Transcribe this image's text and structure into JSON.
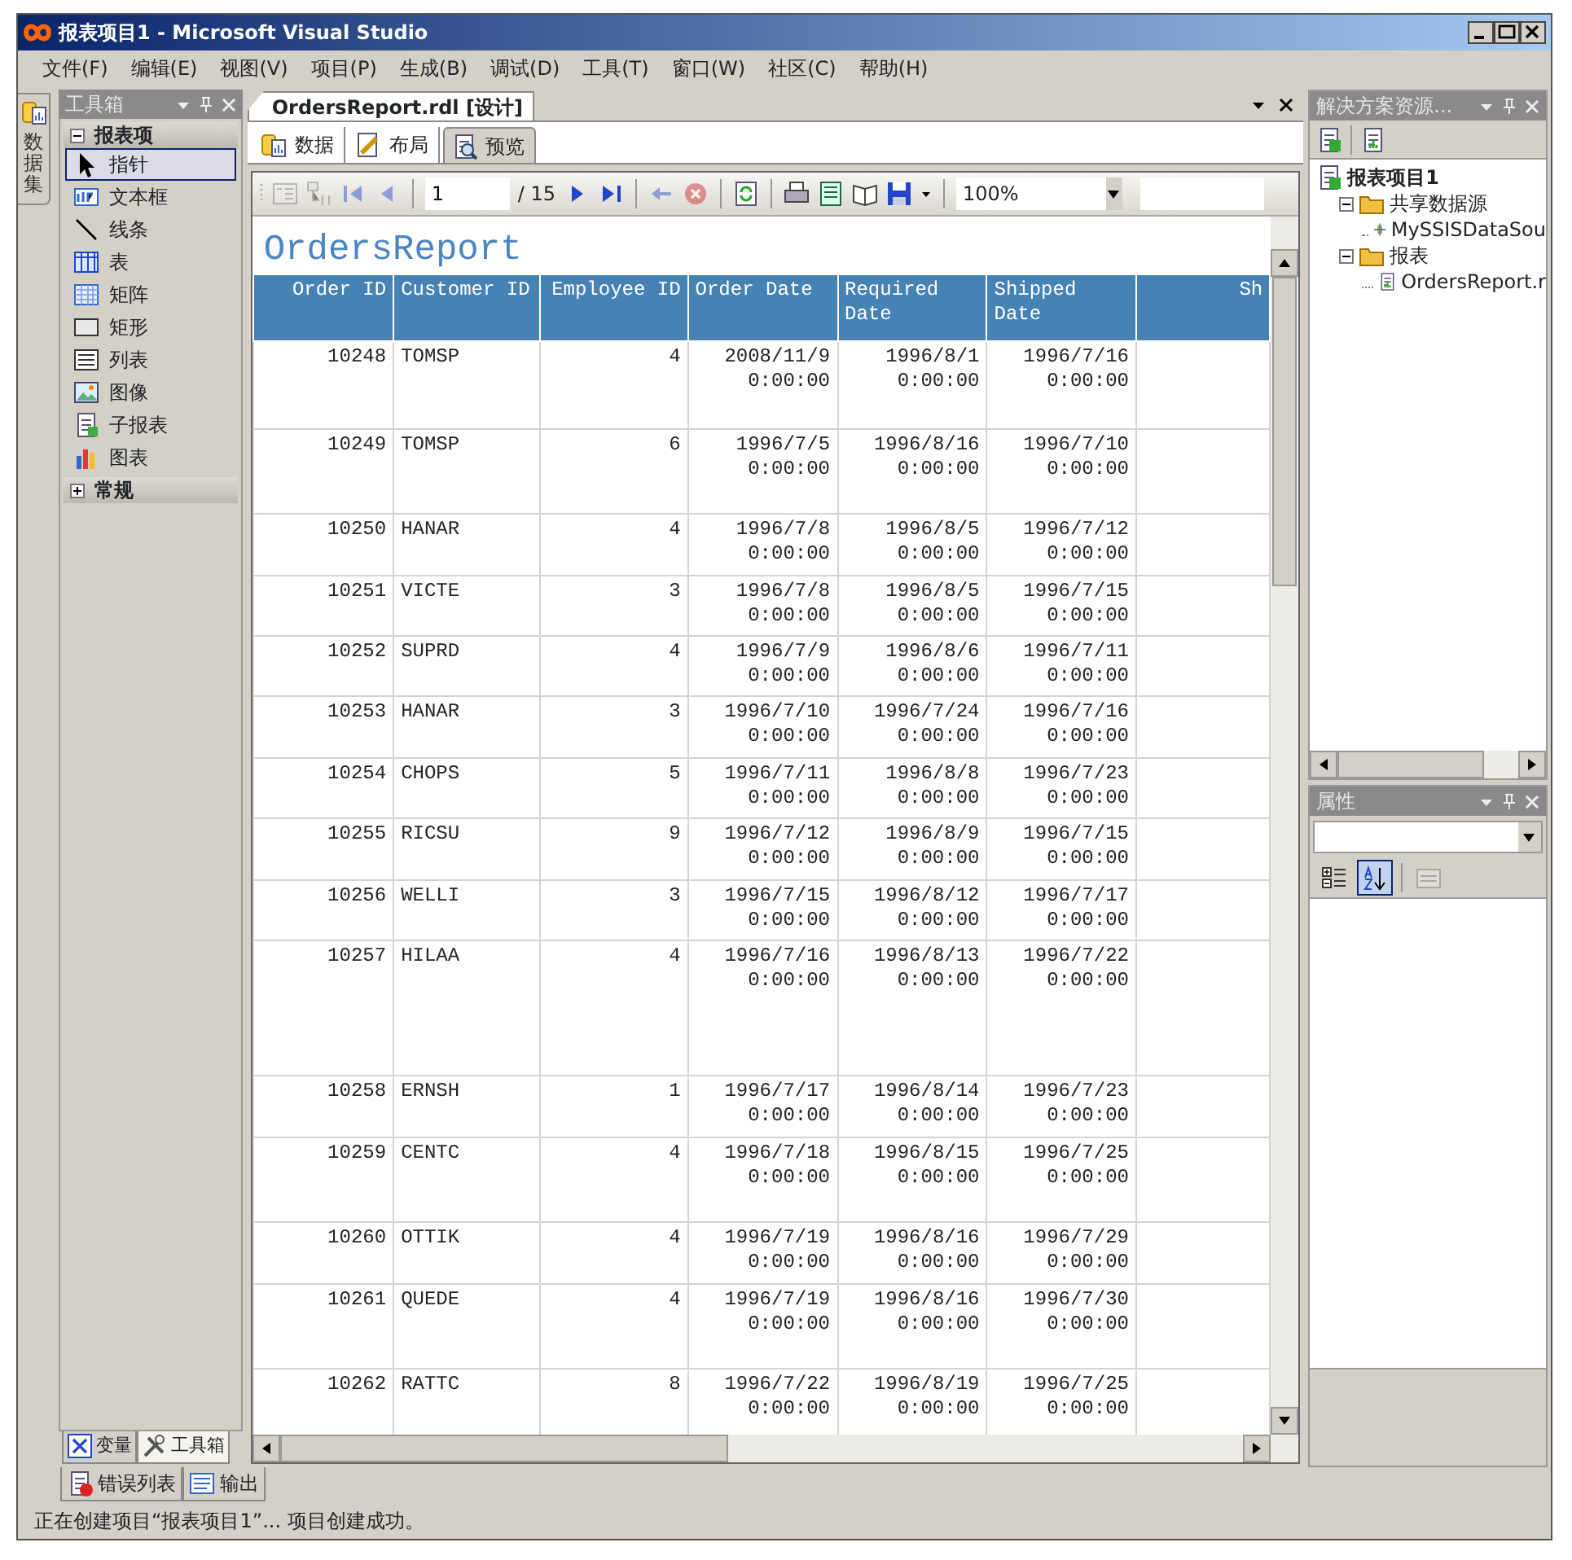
{
  "window": {
    "title": "报表项目1 - Microsoft Visual Studio"
  },
  "menu": [
    "文件(F)",
    "编辑(E)",
    "视图(V)",
    "项目(P)",
    "生成(B)",
    "调试(D)",
    "工具(T)",
    "窗口(W)",
    "社区(C)",
    "帮助(H)"
  ],
  "side_tabs": [
    {
      "label": "数据集"
    }
  ],
  "toolbox": {
    "title": "工具箱",
    "groups": [
      {
        "label": "报表项",
        "expanded": true,
        "items": [
          {
            "label": "指针",
            "kind": "pointer",
            "selected": true
          },
          {
            "label": "文本框",
            "kind": "textbox",
            "selected": false
          },
          {
            "label": "线条",
            "kind": "line",
            "selected": false
          },
          {
            "label": "表",
            "kind": "table",
            "selected": false
          },
          {
            "label": "矩阵",
            "kind": "matrix",
            "selected": false
          },
          {
            "label": "矩形",
            "kind": "rectangle",
            "selected": false
          },
          {
            "label": "列表",
            "kind": "list",
            "selected": false
          },
          {
            "label": "图像",
            "kind": "image",
            "selected": false
          },
          {
            "label": "子报表",
            "kind": "subreport",
            "selected": false
          },
          {
            "label": "图表",
            "kind": "chart",
            "selected": false
          }
        ]
      },
      {
        "label": "常规",
        "expanded": false
      }
    ]
  },
  "toolbox_tabs": [
    {
      "label": "变量",
      "kind": "variables",
      "selected": false
    },
    {
      "label": "工具箱",
      "kind": "toolbox",
      "selected": true
    }
  ],
  "document": {
    "tab": "OrdersReport.rdl [设计]",
    "view_tabs": [
      {
        "label": "数据",
        "kind": "data",
        "selected": false
      },
      {
        "label": "布局",
        "kind": "layout",
        "selected": false
      },
      {
        "label": "预览",
        "kind": "preview",
        "selected": true
      }
    ],
    "viewer_toolbar": {
      "left": [
        {
          "kind": "document-map",
          "disabled": true
        },
        {
          "kind": "parent-report",
          "disabled": true
        },
        {
          "kind": "first-page",
          "disabled": true
        },
        {
          "kind": "previous-page",
          "disabled": true
        }
      ],
      "page": "1",
      "page_total": "/ 15",
      "right": [
        {
          "kind": "next-page",
          "disabled": false
        },
        {
          "kind": "last-page",
          "disabled": false
        },
        {
          "kind": "back",
          "disabled": true
        },
        {
          "kind": "stop",
          "disabled": true
        },
        {
          "kind": "refresh",
          "disabled": false
        },
        {
          "kind": "print",
          "disabled": false
        },
        {
          "kind": "print-layout",
          "disabled": false
        },
        {
          "kind": "page-setup",
          "disabled": false
        },
        {
          "kind": "save",
          "disabled": false
        }
      ],
      "zoom": "100%"
    },
    "report": {
      "title": "OrdersReport",
      "columns": [
        "Order ID",
        "Customer ID",
        "Employee ID",
        "Order Date",
        "Required Date",
        "Shipped Date",
        "Sh"
      ],
      "rows": [
        [
          "10248",
          "TOMSP",
          "4",
          "2008/11/9 0:00:00",
          "1996/8/1 0:00:00",
          "1996/7/16 0:00:00"
        ],
        [
          "10249",
          "TOMSP",
          "6",
          "1996/7/5 0:00:00",
          "1996/8/16 0:00:00",
          "1996/7/10 0:00:00"
        ],
        [
          "10250",
          "HANAR",
          "4",
          "1996/7/8 0:00:00",
          "1996/8/5 0:00:00",
          "1996/7/12 0:00:00"
        ],
        [
          "10251",
          "VICTE",
          "3",
          "1996/7/8 0:00:00",
          "1996/8/5 0:00:00",
          "1996/7/15 0:00:00"
        ],
        [
          "10252",
          "SUPRD",
          "4",
          "1996/7/9 0:00:00",
          "1996/8/6 0:00:00",
          "1996/7/11 0:00:00"
        ],
        [
          "10253",
          "HANAR",
          "3",
          "1996/7/10 0:00:00",
          "1996/7/24 0:00:00",
          "1996/7/16 0:00:00"
        ],
        [
          "10254",
          "CHOPS",
          "5",
          "1996/7/11 0:00:00",
          "1996/8/8 0:00:00",
          "1996/7/23 0:00:00"
        ],
        [
          "10255",
          "RICSU",
          "9",
          "1996/7/12 0:00:00",
          "1996/8/9 0:00:00",
          "1996/7/15 0:00:00"
        ],
        [
          "10256",
          "WELLI",
          "3",
          "1996/7/15 0:00:00",
          "1996/8/12 0:00:00",
          "1996/7/17 0:00:00"
        ],
        [
          "10257",
          "HILAA",
          "4",
          "1996/7/16 0:00:00",
          "1996/8/13 0:00:00",
          "1996/7/22 0:00:00"
        ],
        [
          "10258",
          "ERNSH",
          "1",
          "1996/7/17 0:00:00",
          "1996/8/14 0:00:00",
          "1996/7/23 0:00:00"
        ],
        [
          "10259",
          "CENTC",
          "4",
          "1996/7/18 0:00:00",
          "1996/8/15 0:00:00",
          "1996/7/25 0:00:00"
        ],
        [
          "10260",
          "OTTIK",
          "4",
          "1996/7/19 0:00:00",
          "1996/8/16 0:00:00",
          "1996/7/29 0:00:00"
        ],
        [
          "10261",
          "QUEDE",
          "4",
          "1996/7/19 0:00:00",
          "1996/8/16 0:00:00",
          "1996/7/30 0:00:00"
        ],
        [
          "10262",
          "RATTC",
          "8",
          "1996/7/22 0:00:00",
          "1996/8/19 0:00:00",
          "1996/7/25 0:00:00"
        ]
      ]
    }
  },
  "solution_explorer": {
    "title": "解决方案资源...",
    "tree": [
      {
        "label": "报表项目1",
        "kind": "project",
        "children": [
          {
            "label": "共享数据源",
            "kind": "folder",
            "expanded": true,
            "children": [
              {
                "label": "MySSISDataSou",
                "kind": "datasource"
              }
            ]
          },
          {
            "label": "报表",
            "kind": "folder",
            "expanded": true,
            "children": [
              {
                "label": "OrdersReport.r",
                "kind": "report"
              }
            ]
          }
        ]
      }
    ]
  },
  "properties": {
    "title": "属性",
    "buttons": [
      {
        "kind": "categorized",
        "selected": false
      },
      {
        "kind": "alphabetical",
        "selected": true
      },
      {
        "kind": "property-pages",
        "disabled": true
      }
    ]
  },
  "bottom_tabs": [
    {
      "label": "错误列表",
      "kind": "errors"
    },
    {
      "label": "输出",
      "kind": "output"
    }
  ],
  "status_bar": "正在创建项目“报表项目1”... 项目创建成功。"
}
